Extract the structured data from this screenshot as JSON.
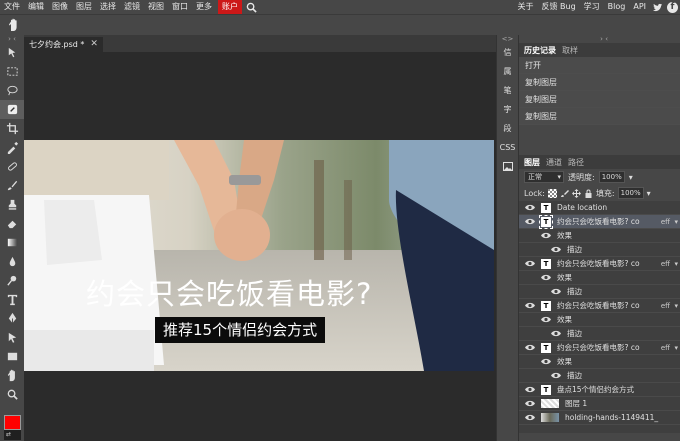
{
  "menu": {
    "items": [
      "文件",
      "编辑",
      "图像",
      "图层",
      "选择",
      "滤镜",
      "视图",
      "窗口",
      "更多"
    ],
    "account": "账户",
    "right": [
      "关于",
      "反馈 Bug",
      "学习",
      "Blog",
      "API"
    ]
  },
  "document": {
    "tab_label": "七夕约会.psd *",
    "close": "✕",
    "headline": "约会只会吃饭看电影?",
    "subtitle": "推荐15个情侣约会方式"
  },
  "side_buttons": [
    "信",
    "属",
    "笔",
    "字",
    "段",
    "CSS"
  ],
  "collapse": {
    "left": "› ‹",
    "mid": "<>",
    "right": "› ‹"
  },
  "history": {
    "tabs": [
      "历史记录",
      "取样"
    ],
    "items": [
      "打开",
      "复制图层",
      "复制图层",
      "复制图层"
    ]
  },
  "layers": {
    "tabs": [
      "图层",
      "通道",
      "路径"
    ],
    "blend_mode": "正常",
    "opacity_label": "透明度:",
    "opacity_value": "100%",
    "lock_label": "Lock:",
    "fill_label": "填充:",
    "fill_value": "100%",
    "rows": [
      {
        "kind": "text",
        "name": "Date location"
      },
      {
        "kind": "text",
        "name": "约会只会吃饭看电影? co",
        "eff": "eff",
        "selected": true
      },
      {
        "kind": "effect",
        "name": "效果"
      },
      {
        "kind": "effect2",
        "name": "描边"
      },
      {
        "kind": "text",
        "name": "约会只会吃饭看电影? co",
        "eff": "eff"
      },
      {
        "kind": "effect",
        "name": "效果"
      },
      {
        "kind": "effect2",
        "name": "描边"
      },
      {
        "kind": "text",
        "name": "约会只会吃饭看电影? co",
        "eff": "eff"
      },
      {
        "kind": "effect",
        "name": "效果"
      },
      {
        "kind": "effect2",
        "name": "描边"
      },
      {
        "kind": "text",
        "name": "约会只会吃饭看电影? co",
        "eff": "eff"
      },
      {
        "kind": "effect",
        "name": "效果"
      },
      {
        "kind": "effect2",
        "name": "描边"
      },
      {
        "kind": "text",
        "name": "盘点15个情侣约会方式"
      },
      {
        "kind": "image-checker",
        "name": "图层 1"
      },
      {
        "kind": "image-photo",
        "name": "holding-hands-1149411_"
      }
    ]
  },
  "colors": {
    "foreground": "#ff0000",
    "background": "#202020",
    "accent": "#cc1818"
  },
  "toolbox_swap_label": "⇄"
}
